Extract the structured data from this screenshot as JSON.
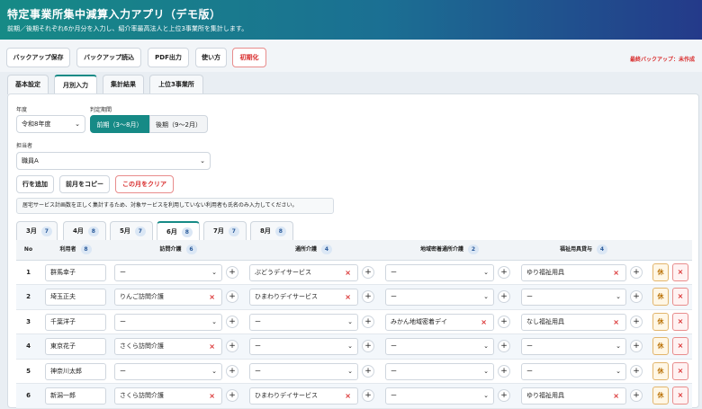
{
  "app": {
    "title": "特定事業所集中減算入力アプリ（デモ版）",
    "subtitle": "前期／後期それぞれ6か月分を入力し、紹介率最高法人と上位3事業所を集計します。"
  },
  "toolbar": {
    "backup_save": "バックアップ保存",
    "backup_load": "バックアップ読込",
    "pdf": "PDF出力",
    "howto": "使い方",
    "reset": "初期化",
    "last_backup": "最終バックアップ：未作成"
  },
  "tabs": [
    "基本設定",
    "月別入力",
    "集計結果",
    "上位3事業所"
  ],
  "form": {
    "year_label": "年度",
    "year_value": "令和8年度",
    "period_label": "判定期間",
    "period_first": "前期（3〜8月）",
    "period_second": "後期（9〜2月）",
    "staff_label": "担当者",
    "staff_value": "職員A",
    "add_row": "行を追加",
    "copy_prev": "前月をコピー",
    "clear_month": "この月をクリア",
    "note": "居宅サービス計画数を正しく集計するため、対象サービスを利用していない利用者も氏名のみ入力してください。"
  },
  "months": [
    {
      "label": "3月",
      "count": "7"
    },
    {
      "label": "4月",
      "count": "8"
    },
    {
      "label": "5月",
      "count": "7"
    },
    {
      "label": "6月",
      "count": "8"
    },
    {
      "label": "7月",
      "count": "7"
    },
    {
      "label": "8月",
      "count": "8"
    }
  ],
  "table": {
    "headers": {
      "no": "No",
      "user": "利用者",
      "user_count": "8",
      "visit": "訪問介護",
      "visit_count": "6",
      "day": "通所介護",
      "day_count": "4",
      "local": "地域密着通所介護",
      "local_count": "2",
      "welfare": "福祉用具貸与",
      "welfare_count": "4"
    },
    "rows": [
      {
        "no": "1",
        "name": "群馬幸子",
        "visit": "ー",
        "day": "ぶどうデイサービス",
        "local": "ー",
        "welfare": "ゆり福祉用具"
      },
      {
        "no": "2",
        "name": "埼玉正夫",
        "visit": "りんご訪問介護",
        "day": "ひまわりデイサービス",
        "local": "ー",
        "welfare": "ー"
      },
      {
        "no": "3",
        "name": "千葉洋子",
        "visit": "ー",
        "day": "ー",
        "local": "みかん地域密着デイ",
        "welfare": "なし福祉用具"
      },
      {
        "no": "4",
        "name": "東京花子",
        "visit": "さくら訪問介護",
        "day": "ー",
        "local": "ー",
        "welfare": "ー"
      },
      {
        "no": "5",
        "name": "神奈川太郎",
        "visit": "ー",
        "day": "ー",
        "local": "ー",
        "welfare": "ー"
      },
      {
        "no": "6",
        "name": "新潟一郎",
        "visit": "さくら訪問介護",
        "day": "ひまわりデイサービス",
        "local": "ー",
        "welfare": "ゆり福祉用具"
      }
    ],
    "rest_label": "休",
    "delete_label": "×",
    "add_label": "+",
    "clear_label": "×",
    "chevron": "⌄"
  }
}
